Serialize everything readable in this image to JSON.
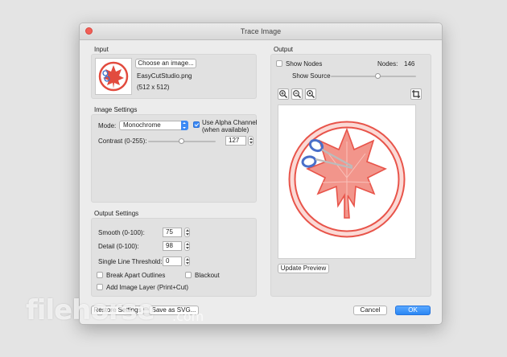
{
  "window": {
    "title": "Trace Image"
  },
  "input": {
    "section_label": "Input",
    "choose_button": "Choose an image...",
    "filename": "EasyCutStudio.png",
    "dimensions": "(512 x 512)"
  },
  "image_settings": {
    "section_label": "Image Settings",
    "mode_label": "Mode:",
    "mode_value": "Monochrome",
    "alpha_label_line1": "Use Alpha Channel",
    "alpha_label_line2": "(when available)",
    "alpha_checked": true,
    "contrast_label": "Contrast (0-255):",
    "contrast_value": "127",
    "contrast_level": 127,
    "contrast_max": 255
  },
  "output_settings": {
    "section_label": "Output Settings",
    "smooth_label": "Smooth (0-100):",
    "smooth_value": "75",
    "detail_label": "Detail (0-100):",
    "detail_value": "98",
    "threshold_label": "Single Line Threshold:",
    "threshold_value": "0",
    "break_apart_label": "Break Apart Outlines",
    "blackout_label": "Blackout",
    "add_layer_label": "Add Image Layer (Print+Cut)"
  },
  "output": {
    "section_label": "Output",
    "show_nodes_label": "Show Nodes",
    "nodes_label": "Nodes:",
    "nodes_value": "146",
    "show_source_label": "Show Source",
    "show_source_level": 0.55,
    "update_preview_label": "Update Preview"
  },
  "footer": {
    "restore_label": "Restore Settings",
    "save_svg_label": "Save as SVG...",
    "cancel_label": "Cancel",
    "ok_label": "OK"
  },
  "watermark": {
    "brand": "filehorse",
    "domain": ".com"
  },
  "colors": {
    "accent": "#3b8af5",
    "leaf": "#ec7369",
    "close": "#f25f57"
  }
}
